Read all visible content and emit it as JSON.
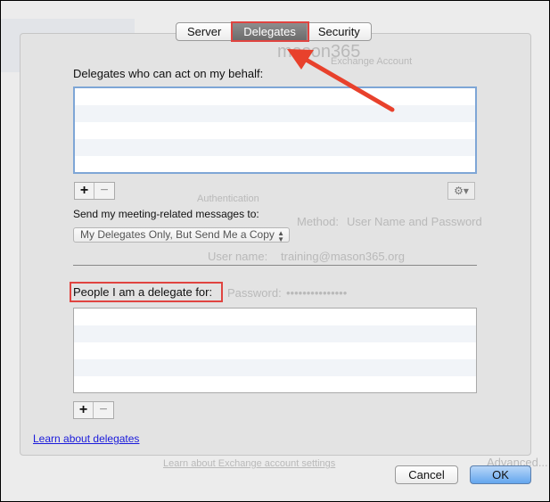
{
  "tabs": [
    {
      "label": "Server",
      "selected": false
    },
    {
      "label": "Delegates",
      "selected": true
    },
    {
      "label": "Security",
      "selected": false
    }
  ],
  "delegates_label": "Delegates who can act on my behalf:",
  "send_label": "Send my meeting-related messages to:",
  "send_popup_value": "My Delegates Only, But Send Me a Copy",
  "people_label": "People I am a delegate for:",
  "add_label": "+",
  "remove_label": "−",
  "gear_icon": "gear-icon",
  "learn_link": "Learn about delegates",
  "cancel_label": "Cancel",
  "ok_label": "OK",
  "background": {
    "account_name": "mason365",
    "account_type": "Exchange Account",
    "authentication": "Authentication",
    "method_label": "Method:",
    "method_value": "User Name and Password",
    "user_label": "User name:",
    "user_value": "training@mason365.org",
    "password_label": "Password:",
    "password_value": "•••••••••••••••",
    "learn_exchange": "Learn about Exchange account settings",
    "advanced": "Advanced..."
  },
  "colors": {
    "highlight": "#e04440",
    "accent": "#64a6ee"
  }
}
